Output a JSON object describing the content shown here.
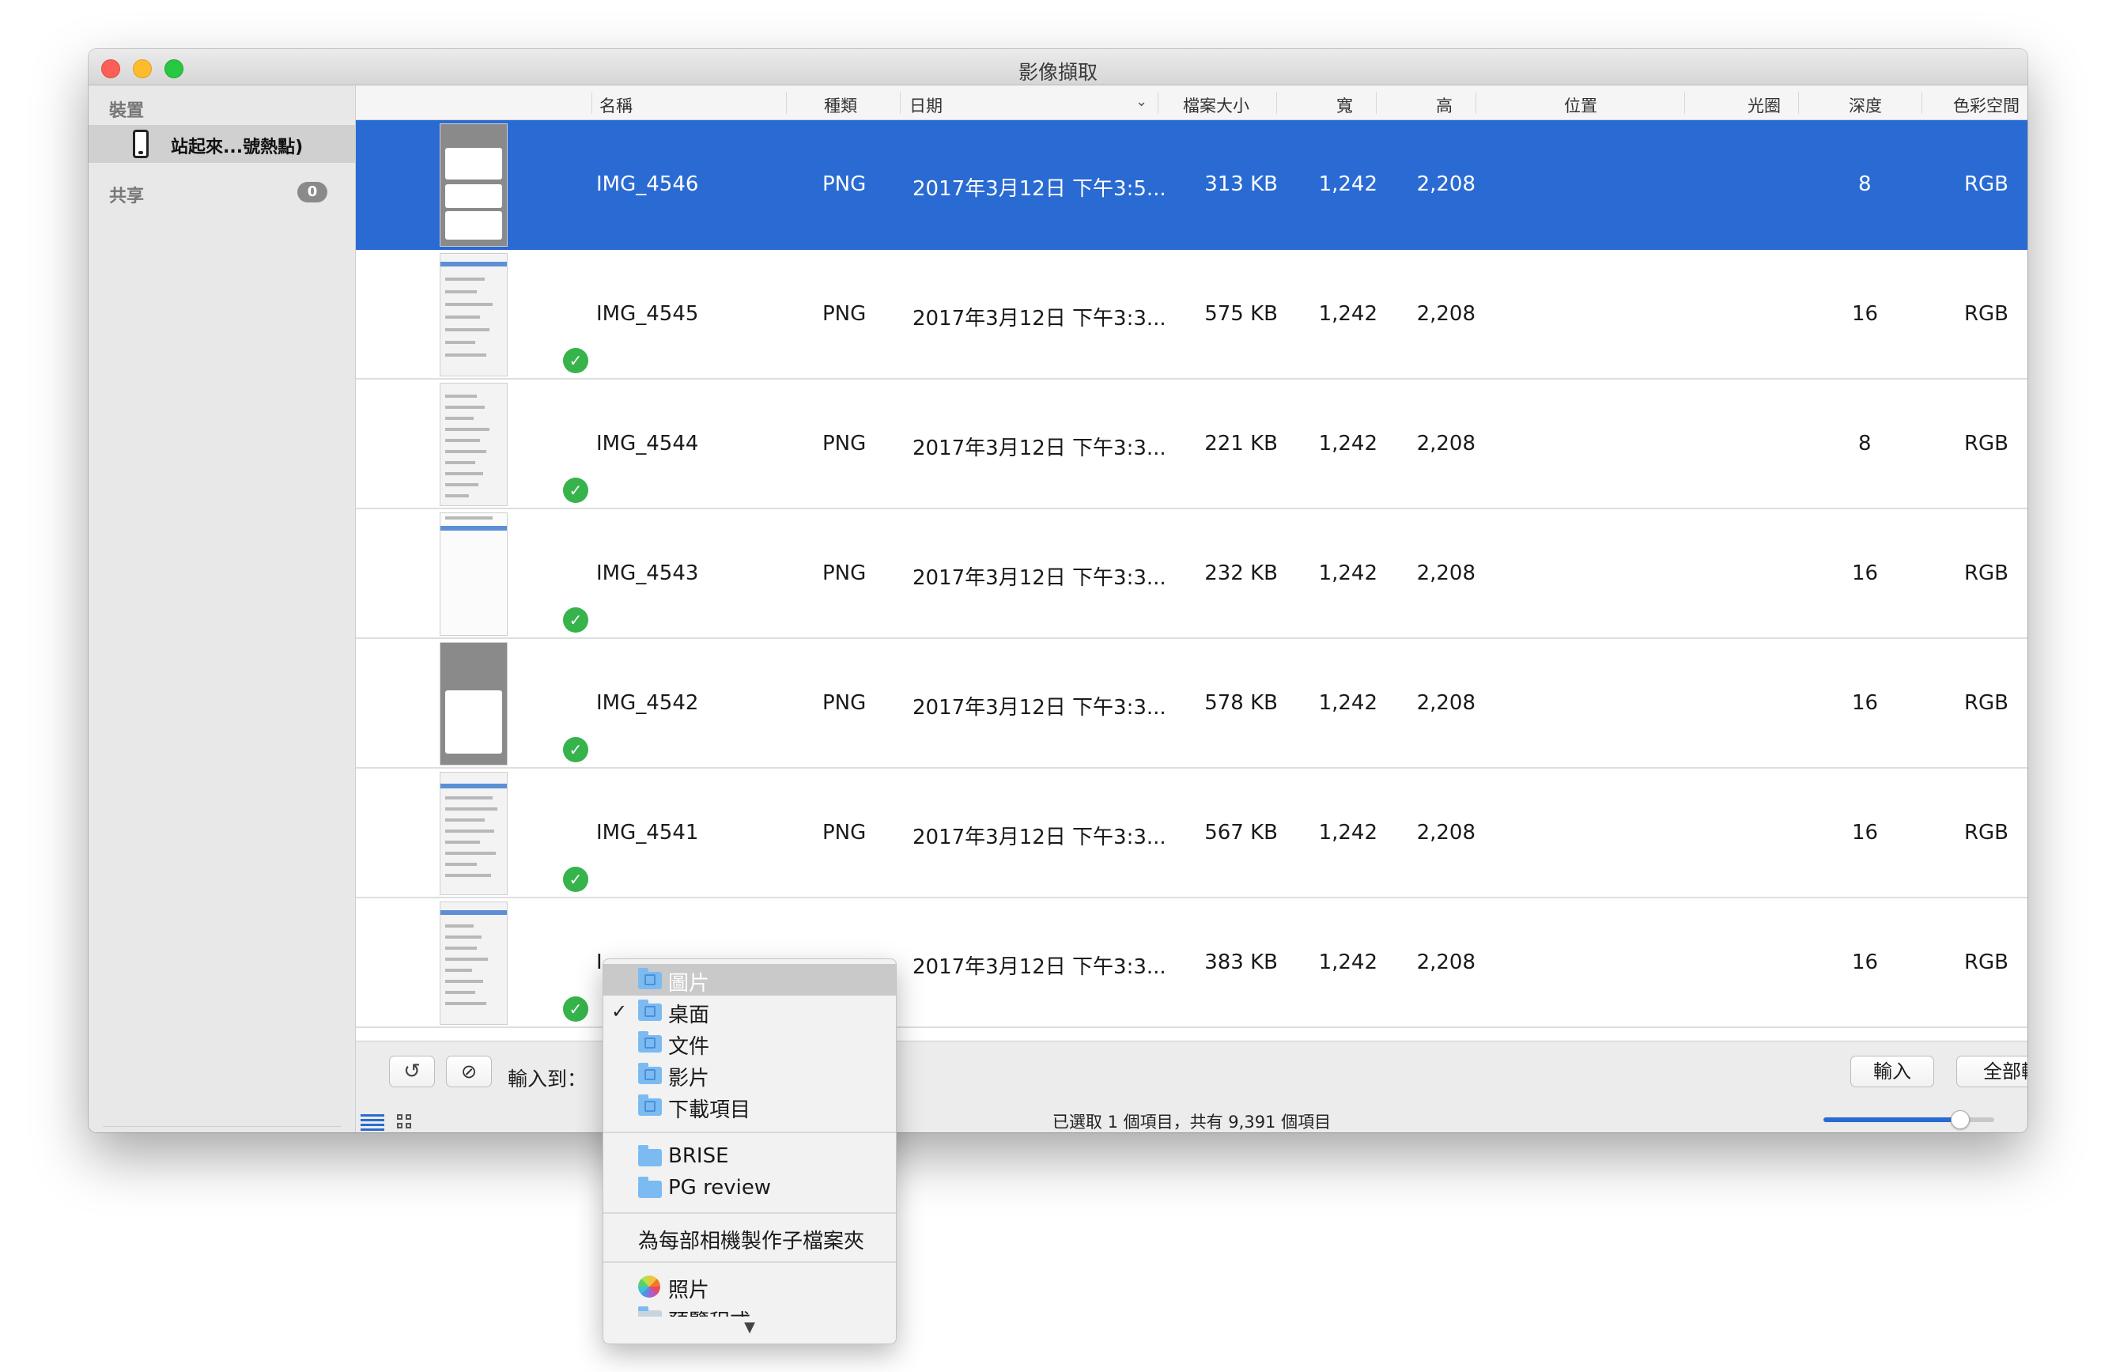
{
  "window": {
    "title": "影像擷取"
  },
  "sidebar": {
    "devices_header": "裝置",
    "device_name": "站起來...號熱點)",
    "shared_header": "共享",
    "shared_count": "0"
  },
  "table": {
    "columns": {
      "name": "名稱",
      "kind": "種類",
      "date": "日期",
      "size": "檔案大小",
      "width": "寬",
      "height": "高",
      "location": "位置",
      "aperture": "光圈",
      "depth": "深度",
      "colorspace": "色彩空間"
    },
    "rows": [
      {
        "name": "IMG_4546",
        "kind": "PNG",
        "date": "2017年3月12日 下午3:5...",
        "size": "313 KB",
        "width": "1,242",
        "height": "2,208",
        "depth": "8",
        "colorspace": "RGB",
        "imported": false,
        "selected": true
      },
      {
        "name": "IMG_4545",
        "kind": "PNG",
        "date": "2017年3月12日 下午3:3...",
        "size": "575 KB",
        "width": "1,242",
        "height": "2,208",
        "depth": "16",
        "colorspace": "RGB",
        "imported": true,
        "selected": false
      },
      {
        "name": "IMG_4544",
        "kind": "PNG",
        "date": "2017年3月12日 下午3:3...",
        "size": "221 KB",
        "width": "1,242",
        "height": "2,208",
        "depth": "8",
        "colorspace": "RGB",
        "imported": true,
        "selected": false
      },
      {
        "name": "IMG_4543",
        "kind": "PNG",
        "date": "2017年3月12日 下午3:3...",
        "size": "232 KB",
        "width": "1,242",
        "height": "2,208",
        "depth": "16",
        "colorspace": "RGB",
        "imported": true,
        "selected": false
      },
      {
        "name": "IMG_4542",
        "kind": "PNG",
        "date": "2017年3月12日 下午3:3...",
        "size": "578 KB",
        "width": "1,242",
        "height": "2,208",
        "depth": "16",
        "colorspace": "RGB",
        "imported": true,
        "selected": false
      },
      {
        "name": "IMG_4541",
        "kind": "PNG",
        "date": "2017年3月12日 下午3:3...",
        "size": "567 KB",
        "width": "1,242",
        "height": "2,208",
        "depth": "16",
        "colorspace": "RGB",
        "imported": true,
        "selected": false
      },
      {
        "name": "I",
        "kind": "",
        "date": "2017年3月12日 下午3:3...",
        "size": "383 KB",
        "width": "1,242",
        "height": "2,208",
        "depth": "16",
        "colorspace": "RGB",
        "imported": true,
        "selected": false
      }
    ]
  },
  "toolbar": {
    "rotate_icon": "rotate-left-icon",
    "delete_icon": "no-entry-icon",
    "import_to_label": "輸入到：",
    "import_button": "輸入",
    "import_all_button": "全部輸入",
    "status": "已選取 1 個項目，共有 9,391 個項目",
    "thumbnail_size": 0.8
  },
  "menu": {
    "items": [
      {
        "label": "圖片",
        "icon": "pictures-folder-icon",
        "highlighted": true,
        "checked": false
      },
      {
        "label": "桌面",
        "icon": "desktop-folder-icon",
        "highlighted": false,
        "checked": true
      },
      {
        "label": "文件",
        "icon": "documents-folder-icon",
        "highlighted": false,
        "checked": false
      },
      {
        "label": "影片",
        "icon": "movies-folder-icon",
        "highlighted": false,
        "checked": false
      },
      {
        "label": "下載項目",
        "icon": "downloads-folder-icon",
        "highlighted": false,
        "checked": false
      }
    ],
    "folders": [
      {
        "label": "BRISE",
        "icon": "folder-icon"
      },
      {
        "label": "PG review",
        "icon": "folder-icon"
      }
    ],
    "subfolder_option": "為每部相機製作子檔案夾",
    "apps": [
      {
        "label": "照片",
        "icon": "photos-app-icon"
      },
      {
        "label": "預覽程式",
        "icon": "preview-app-icon"
      }
    ],
    "more_indicator": "▼"
  },
  "colors": {
    "selection": "#2a6ad3",
    "imported_check": "#36b34a",
    "folder": "#7bbbf2"
  }
}
